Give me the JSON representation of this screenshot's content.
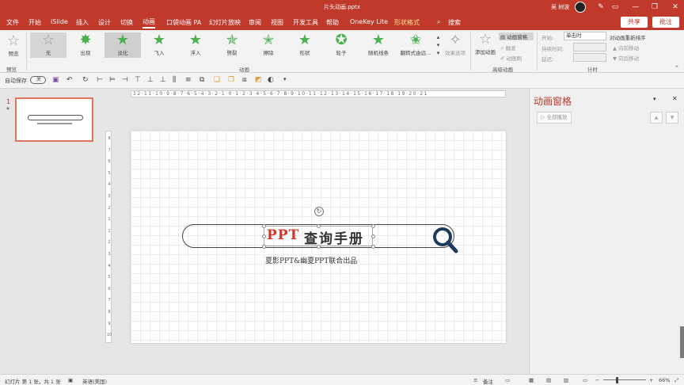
{
  "window": {
    "title": "片头动画.pptx",
    "user": "吴 树波"
  },
  "tabs": [
    "文件",
    "开始",
    "iSlide",
    "插入",
    "设计",
    "切换",
    "动画",
    "口袋动画 PA",
    "幻灯片放映",
    "审阅",
    "视图",
    "开发工具",
    "帮助",
    "OneKey Lite",
    "形状格式"
  ],
  "active_tab": "动画",
  "tell_me": "搜索",
  "share_label": "共享",
  "comment_label": "批注",
  "ribbon": {
    "preview": {
      "label": "预览",
      "group": "预览"
    },
    "animations": [
      "无",
      "出现",
      "淡化",
      "飞入",
      "浮入",
      "劈裂",
      "擦除",
      "形状",
      "轮子",
      "随机线条",
      "翻转式由远..."
    ],
    "selected_animation": "淡化",
    "effect_options": "效果选项",
    "group_animation": "动画",
    "add_animation": "添加动画",
    "anim_pane_btn": "动画窗格",
    "trigger": "触发",
    "anim_painter": "动画刷",
    "group_advanced": "高级动画",
    "start_label": "开始:",
    "start_value": "单击时",
    "duration_label": "持续时间:",
    "delay_label": "延迟:",
    "reorder_title": "对动画重新排序",
    "move_earlier": "向前移动",
    "move_later": "向后移动",
    "group_timing": "计时"
  },
  "qat": {
    "autosave": "自动保存",
    "autosave_state": "关"
  },
  "slides": {
    "number": "1",
    "star": "*"
  },
  "slide": {
    "title_red": "PPT",
    "title_black": "查询手册",
    "subtitle": "夏影PPT&幽夏PPT联合出品"
  },
  "ruler": {
    "h": "12·11·10·9·8·7·6·5·4·3·2·1·0·1·2·3·4·5·6·7·8·9·10·11·12·13·14·15·16·17·18·19·20·21",
    "v": [
      "8",
      "7",
      "6",
      "5",
      "4",
      "3",
      "2",
      "1",
      "1",
      "2",
      "3",
      "4",
      "5",
      "6",
      "7",
      "8",
      "9",
      "10"
    ]
  },
  "anim_pane": {
    "title": "动画窗格",
    "play_all": "全部播放"
  },
  "status": {
    "slide_info": "幻灯片 第 1 张，共 1 张",
    "language": "英语(美国)",
    "notes": "备注",
    "zoom": "66%"
  },
  "colors": {
    "accent": "#c0392b",
    "title_red": "#d9322b",
    "thumb_border": "#e2765a"
  }
}
